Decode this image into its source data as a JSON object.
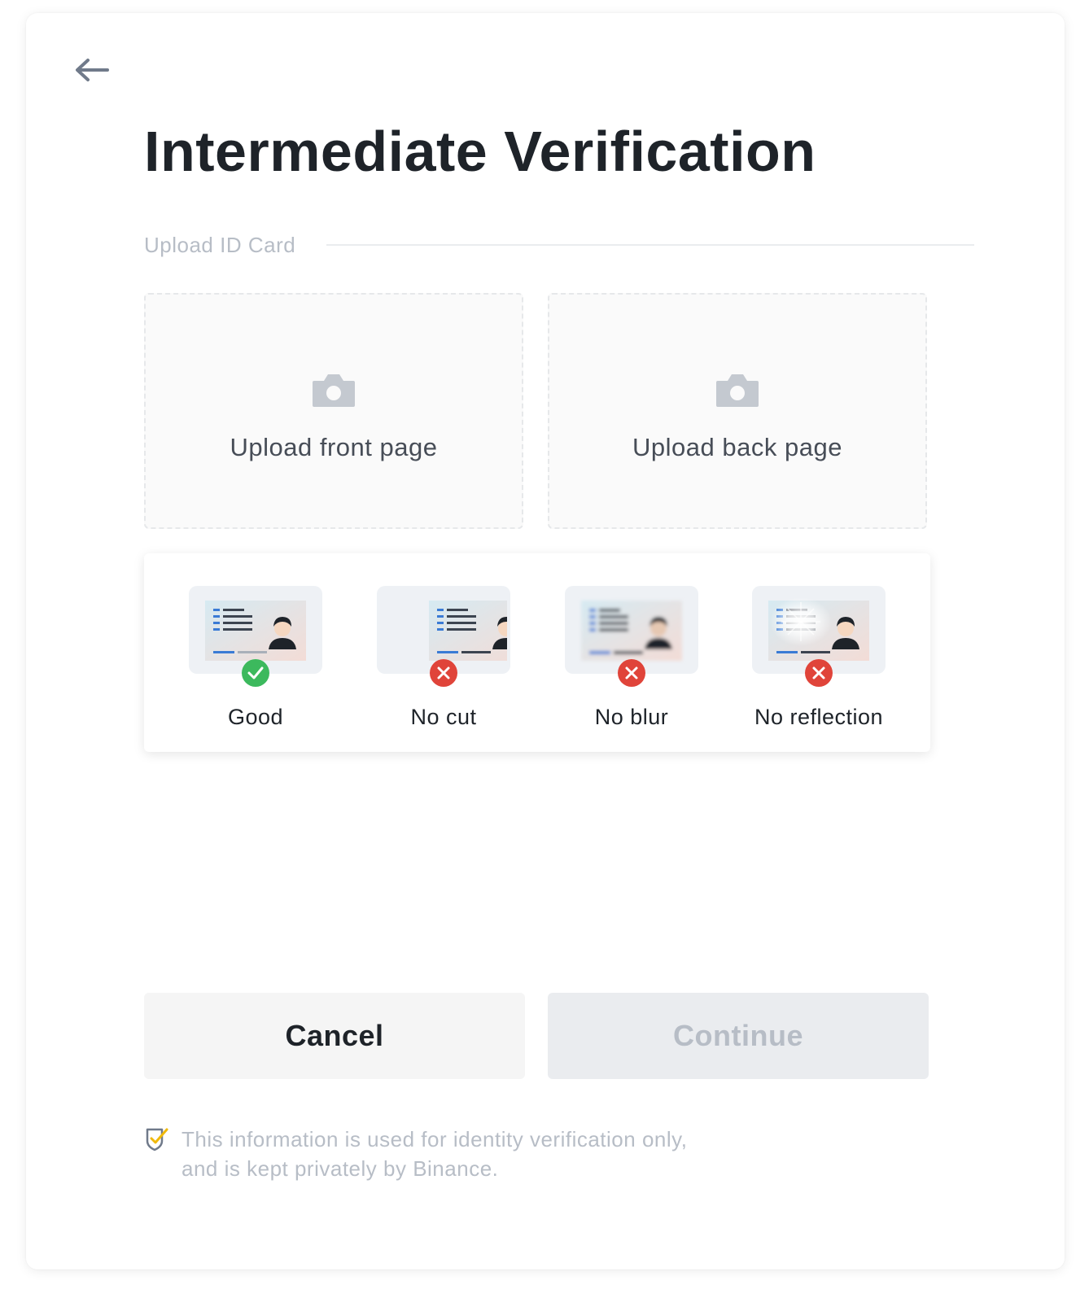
{
  "title": "Intermediate Verification",
  "section_label": "Upload ID Card",
  "uploads": {
    "front_label": "Upload front page",
    "back_label": "Upload back page"
  },
  "guidelines": [
    {
      "label": "Good",
      "status": "ok",
      "icon": "check-icon"
    },
    {
      "label": "No cut",
      "status": "bad",
      "icon": "cross-icon"
    },
    {
      "label": "No blur",
      "status": "bad",
      "icon": "cross-icon"
    },
    {
      "label": "No reflection",
      "status": "bad",
      "icon": "cross-icon"
    }
  ],
  "buttons": {
    "cancel": "Cancel",
    "continue": "Continue"
  },
  "privacy": {
    "line1": "This information is used for identity verification only,",
    "line2": "and is kept privately by Binance."
  },
  "colors": {
    "accent": "#f0b90b",
    "success": "#3cb95d",
    "error": "#e0443a",
    "text_primary": "#1e2329",
    "text_muted": "#b7bdc6"
  }
}
